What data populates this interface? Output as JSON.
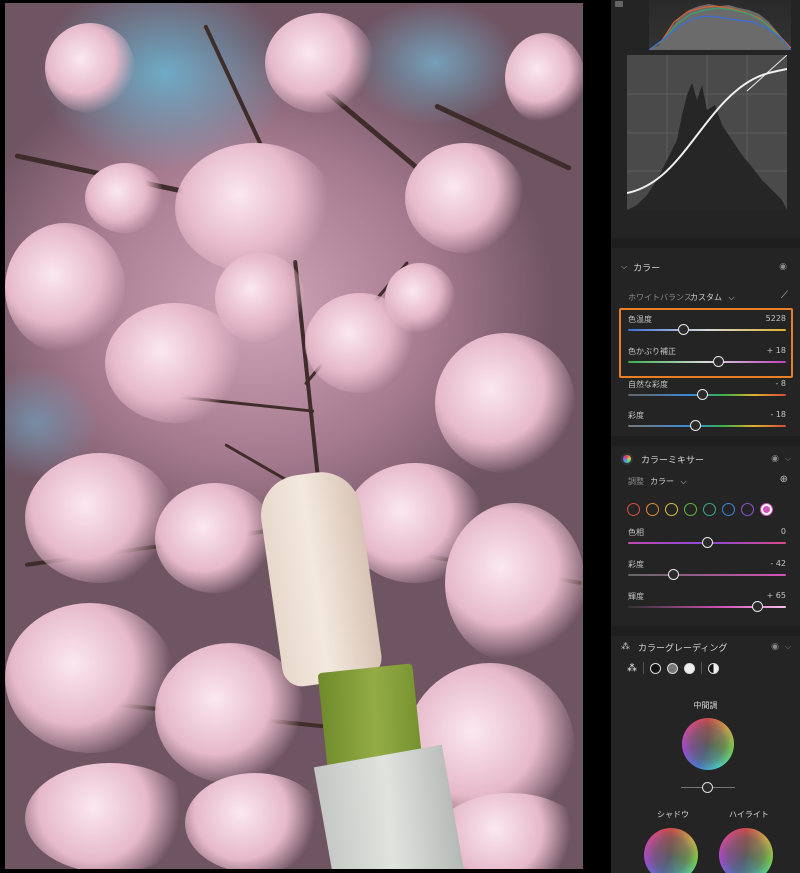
{
  "panel": {
    "color_section": {
      "title": "カラー",
      "white_balance_label": "ホワイトバランス",
      "white_balance_value": "カスタム",
      "sliders": [
        {
          "label": "色温度",
          "value": "5228",
          "position": 0.35
        },
        {
          "label": "色かぶり補正",
          "value": "+ 18",
          "position": 0.57
        },
        {
          "label": "自然な彩度",
          "value": "- 8",
          "position": 0.47
        },
        {
          "label": "彩度",
          "value": "- 18",
          "position": 0.43
        }
      ]
    },
    "color_mixer": {
      "title": "カラーミキサー",
      "adjust_label": "調整",
      "adjust_value": "カラー",
      "swatches": [
        "#d9503a",
        "#e08a2a",
        "#d8c23a",
        "#5db83a",
        "#3aa88e",
        "#3a86d8",
        "#8a52d8",
        "#d252b8"
      ],
      "sliders": [
        {
          "label": "色相",
          "value": "0",
          "position": 0.5
        },
        {
          "label": "彩度",
          "value": "- 42",
          "position": 0.29
        },
        {
          "label": "輝度",
          "value": "+ 65",
          "position": 0.82
        }
      ]
    },
    "color_grading": {
      "title": "カラーグレーディング",
      "midtones_label": "中間調",
      "shadows_label": "シャドウ",
      "highlights_label": "ハイライト"
    }
  },
  "colors": {
    "accent_highlight": "#ea7f27",
    "panel_bg": "#1e1e1e",
    "section_bg": "#242424"
  }
}
